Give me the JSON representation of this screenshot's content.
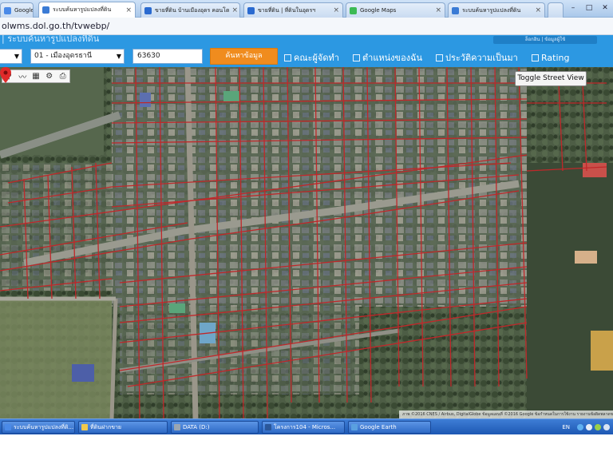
{
  "browser": {
    "tabs": [
      {
        "label": "Google S",
        "favicon_color": "#4a8ae8"
      },
      {
        "label": "ระบบค้นหารูปแปลงที่ดิน",
        "favicon_color": "#3a7bd5"
      },
      {
        "label": "ขายที่ดิน บ้านเมืองอุดร คอนโด",
        "favicon_color": "#2a6ad0"
      },
      {
        "label": "ขายที่ดิน | ที่ดินในอุดรฯ",
        "favicon_color": "#2a6ad0"
      },
      {
        "label": "Google Maps",
        "favicon_color": "#3cba54"
      },
      {
        "label": "ระบบค้นหารูปแปลงที่ดิน",
        "favicon_color": "#3a7bd5"
      }
    ],
    "url": "olwms.dol.go.th/tvwebp/",
    "controls": {
      "minimize": "–",
      "maximize": "□",
      "close": "✕"
    }
  },
  "site": {
    "title": "| ระบบค้นหารูปแปลงที่ดิน",
    "header_right": "ล็อกอิน | ข้อมูลผู้ใช้"
  },
  "search": {
    "province_value": "",
    "district_value": "01 - เมืองอุดรธานี",
    "parcel_value": "63630",
    "search_label": "ค้นหาข้อมูล",
    "checkboxes": [
      {
        "label": "คณะผู้จัดทำ"
      },
      {
        "label": "ตำแหน่งของฉัน"
      },
      {
        "label": "ประวัติความเป็นมา"
      },
      {
        "label": "Rating"
      }
    ]
  },
  "map": {
    "toolbar_icons": [
      "pin-icon",
      "polyline-icon",
      "area-icon",
      "gear-icon",
      "print-icon"
    ],
    "toggle_label": "Toggle Street View",
    "attribution": "ภาพ ©2016 CNES / Airbus, DigitalGlobe   ข้อมูลแผนที่ ©2016 Google   ข้อกำหนดในการใช้งาน   รายงานข้อผิดพลาดของแผนที่",
    "parcel_border_color": "#c0282a",
    "pin_color": "#e02a2a"
  },
  "taskbar": {
    "items": [
      {
        "label": "ระบบค้นหารูปแปลงที่ดิ...",
        "icon_color": "#4a8ae8"
      },
      {
        "label": "ที่ดินฝากขาย",
        "icon_color": "#f2c94c"
      },
      {
        "label": "DATA (D:)",
        "icon_color": "#9aa6b2"
      },
      {
        "label": "โครงการ104 - Micros...",
        "icon_color": "#2b579a"
      },
      {
        "label": "Google Earth",
        "icon_color": "#5aa0e0"
      }
    ],
    "lang": "EN"
  }
}
